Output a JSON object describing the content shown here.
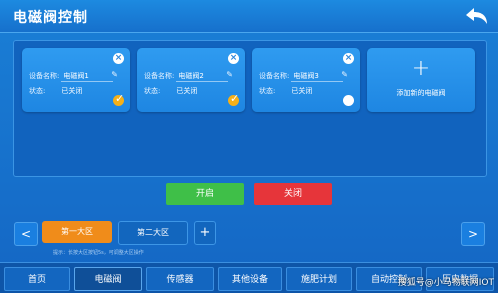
{
  "header": {
    "title": "电磁阀控制"
  },
  "cards": [
    {
      "name_label": "设备名称:",
      "name_value": "电磁阀1",
      "status_label": "状态:",
      "status_value": "已关闭",
      "checked": true
    },
    {
      "name_label": "设备名称:",
      "name_value": "电磁阀2",
      "status_label": "状态:",
      "status_value": "已关闭",
      "checked": true
    },
    {
      "name_label": "设备名称:",
      "name_value": "电磁阀3",
      "status_label": "状态:",
      "status_value": "已关闭",
      "checked": false
    }
  ],
  "add_card": {
    "plus": "+",
    "label": "添加新的电磁阀"
  },
  "actions": {
    "open_label": "开启",
    "close_label": "关闭"
  },
  "zones": {
    "tabs": [
      "第一大区",
      "第二大区"
    ],
    "active_index": 0,
    "add_label": "+",
    "prev": "<",
    "next": ">"
  },
  "hint": "提示：长按大区按钮5s，可调整大区操作",
  "nav": {
    "items": [
      "首页",
      "电磁阀",
      "传感器",
      "其他设备",
      "施肥计划",
      "自动控制",
      "历史数据"
    ],
    "active_index": 1
  },
  "watermark": "搜狐号@小马物联网IOT",
  "colors": {
    "accent_orange": "#f08c1a",
    "open_green": "#3fbf48",
    "close_red": "#e6353a"
  }
}
